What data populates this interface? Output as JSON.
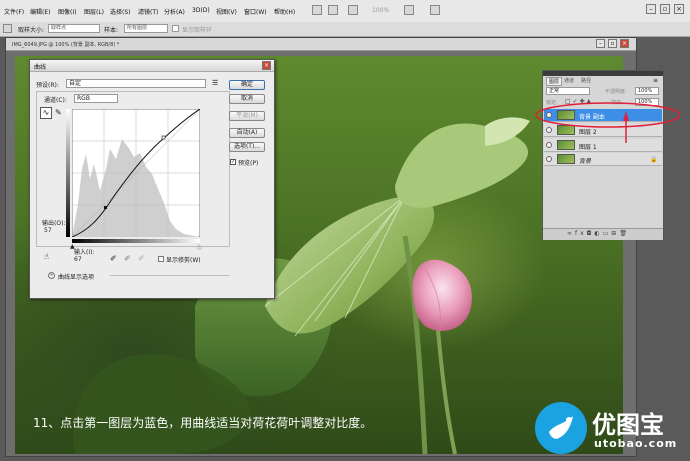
{
  "menubar": {
    "items": [
      "文件(F)",
      "编辑(E)",
      "图像(I)",
      "图层(L)",
      "选择(S)",
      "滤镜(T)",
      "分析(A)",
      "3D(D)",
      "视图(V)",
      "窗口(W)",
      "帮助(H)"
    ],
    "zoom": "100%"
  },
  "options": {
    "tool_size_label": "取样大小:",
    "tool_size_value": "取样点",
    "sample_label": "样本:",
    "sample_value": "所有图层",
    "show_ring_label": "显示取样环"
  },
  "document": {
    "tab_title": "IMG_6049.JPG @ 100% (背景 副本, RGB/8) *"
  },
  "curves": {
    "title": "曲线",
    "preset_label": "预设(R):",
    "preset_value": "自定",
    "channel_label": "通道(C):",
    "channel_value": "RGB",
    "output_label": "输出(O):",
    "output_value": "57",
    "input_label": "输入(I):",
    "input_value": "67",
    "show_clipping_label": "显示修剪(W)",
    "display_options_label": "曲线显示选项",
    "buttons": {
      "ok": "确定",
      "cancel": "取消",
      "smooth": "平滑(M)",
      "auto": "自动(A)",
      "options": "选项(T)..."
    },
    "preview_label": "预览(P)"
  },
  "layers": {
    "tabs": [
      "图层",
      "通道",
      "路径"
    ],
    "blend_mode": "正常",
    "opacity_label": "不透明度:",
    "opacity_value": "100%",
    "lock_label": "锁定:",
    "fill_label": "填充:",
    "fill_value": "100%",
    "items": [
      {
        "name": "背景 副本",
        "selected": true
      },
      {
        "name": "图层 2",
        "selected": false
      },
      {
        "name": "图层 1",
        "selected": false
      },
      {
        "name": "背景",
        "selected": false
      }
    ]
  },
  "caption": "11、点击第一图层为蓝色，用曲线适当对荷花荷叶调整对比度。",
  "watermark": {
    "main": "优图宝",
    "url": "utobao.com"
  }
}
